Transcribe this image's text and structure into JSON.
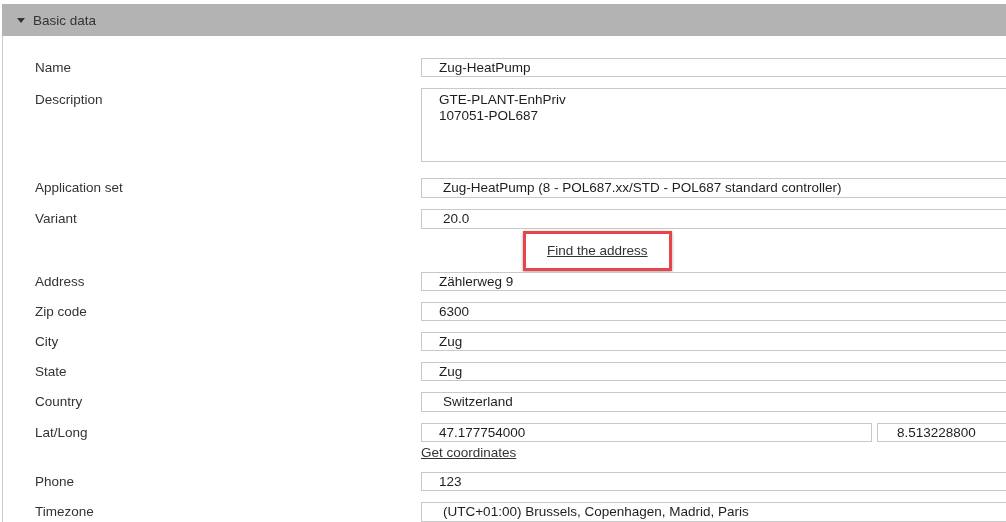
{
  "section": {
    "title": "Basic data",
    "expanded": true
  },
  "fields": [
    {
      "kind": "text",
      "label": "Name",
      "value": "Zug-HeatPump"
    },
    {
      "kind": "textarea",
      "label": "Description",
      "value": "GTE-PLANT-EnhPriv\n107051-POL687"
    },
    {
      "kind": "select",
      "label": "Application set",
      "value": "Zug-HeatPump (8 - POL687.xx/STD - POL687 standard controller)"
    },
    {
      "kind": "select",
      "label": "Variant",
      "value": "20.0"
    },
    {
      "kind": "action",
      "text": "Find the address",
      "highlighted": true
    },
    {
      "kind": "text",
      "label": "Address",
      "value": "Zählerweg 9"
    },
    {
      "kind": "text",
      "label": "Zip code",
      "value": "6300"
    },
    {
      "kind": "text",
      "label": "City",
      "value": "Zug"
    },
    {
      "kind": "text",
      "label": "State",
      "value": "Zug"
    },
    {
      "kind": "select",
      "label": "Country",
      "value": "Switzerland"
    },
    {
      "kind": "pair",
      "label": "Lat/Long",
      "values": [
        "47.177754000",
        "8.513228800"
      ],
      "link": "Get coordinates"
    },
    {
      "kind": "text",
      "label": "Phone",
      "value": "123"
    },
    {
      "kind": "select",
      "label": "Timezone",
      "value": "(UTC+01:00) Brussels, Copenhagen, Madrid, Paris"
    }
  ]
}
